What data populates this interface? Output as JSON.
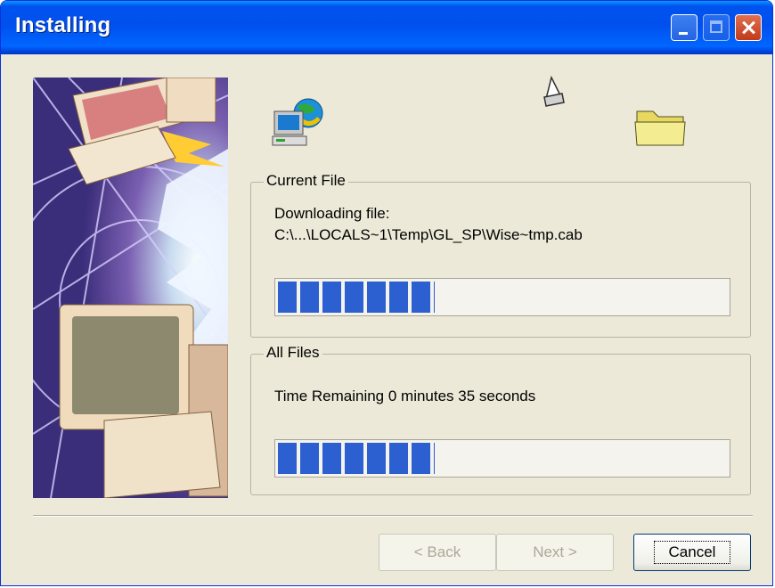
{
  "window": {
    "title": "Installing"
  },
  "current_file": {
    "group_title": "Current File",
    "line1": "Downloading file:",
    "line2": "C:\\...\\LOCALS~1\\Temp\\GL_SP\\Wise~tmp.cab",
    "progress_percent": 35
  },
  "all_files": {
    "group_title": "All Files",
    "time_remaining": "Time Remaining 0 minutes 35 seconds",
    "progress_percent": 35
  },
  "buttons": {
    "back": "< Back",
    "next": "Next >",
    "cancel": "Cancel"
  },
  "icons": [
    "computer-globe-icon",
    "floppy-disk-icon",
    "folder-icon",
    "minimize-icon",
    "maximize-icon",
    "close-icon"
  ],
  "colors": {
    "titlebar": "#0054e3",
    "progress": "#2c60d0",
    "dialog_bg": "#ece9d8"
  }
}
